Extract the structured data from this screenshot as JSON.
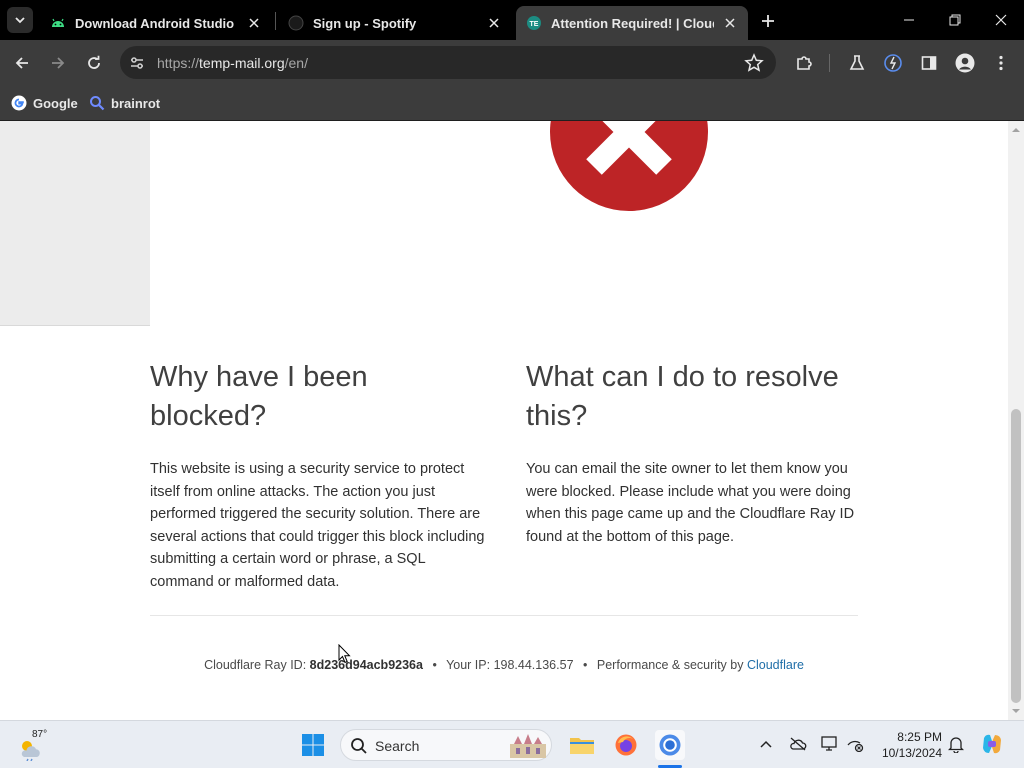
{
  "browser": {
    "tabs": [
      {
        "title": "Download Android Studio & App",
        "favicon": "android-icon"
      },
      {
        "title": "Sign up - Spotify",
        "favicon": "spotify-icon"
      },
      {
        "title": "Attention Required! | Cloudflare",
        "favicon": "temp-mail-icon",
        "active": true
      }
    ],
    "url_prefix": "https://",
    "url_host": "temp-mail.org",
    "url_path": "/en/",
    "bookmarks": [
      {
        "label": "Google",
        "icon": "google-icon"
      },
      {
        "label": "brainrot",
        "icon": "search-icon"
      }
    ]
  },
  "page": {
    "why_heading": "Why have I been blocked?",
    "why_body": "This website is using a security service to protect itself from online attacks. The action you just performed triggered the security solution. There are several actions that could trigger this block including submitting a certain word or phrase, a SQL command or malformed data.",
    "what_heading": "What can I do to resolve this?",
    "what_body": "You can email the site owner to let them know you were blocked. Please include what you were doing when this page came up and the Cloudflare Ray ID found at the bottom of this page.",
    "footer": {
      "ray_label": "Cloudflare Ray ID: ",
      "ray_id": "8d236d94acb9236a",
      "ip_label": "Your IP: ",
      "ip": "198.44.136.57",
      "perf_label": "Performance & security by ",
      "perf_link": "Cloudflare",
      "separator": "•"
    },
    "accent_color": "#bd2426"
  },
  "taskbar": {
    "weather_temp": "87°",
    "search_label": "Search",
    "time": "8:25 PM",
    "date": "10/13/2024"
  }
}
